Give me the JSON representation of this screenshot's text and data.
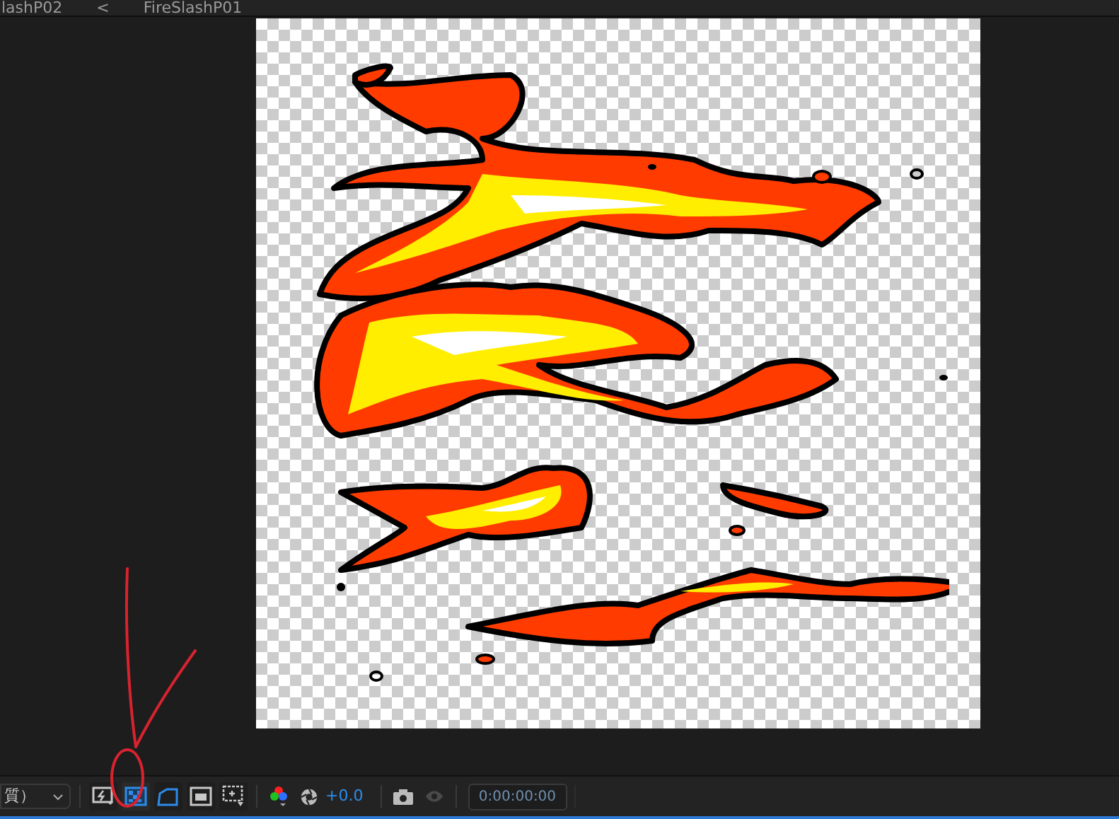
{
  "breadcrumb": [
    {
      "label": "lashP02"
    },
    {
      "label": "<"
    },
    {
      "label": "FireSlashP01"
    }
  ],
  "toolbar": {
    "resolution": "質）",
    "buttons": [
      {
        "kind": "snapshot-fast",
        "selected": false
      },
      {
        "kind": "transparency-grid",
        "selected": true
      },
      {
        "kind": "mask-path",
        "selected": false
      },
      {
        "kind": "region",
        "selected": false
      },
      {
        "kind": "safe-zones",
        "selected": false
      }
    ],
    "exposure": "+0.0",
    "timecode": "0:00:00:00"
  }
}
